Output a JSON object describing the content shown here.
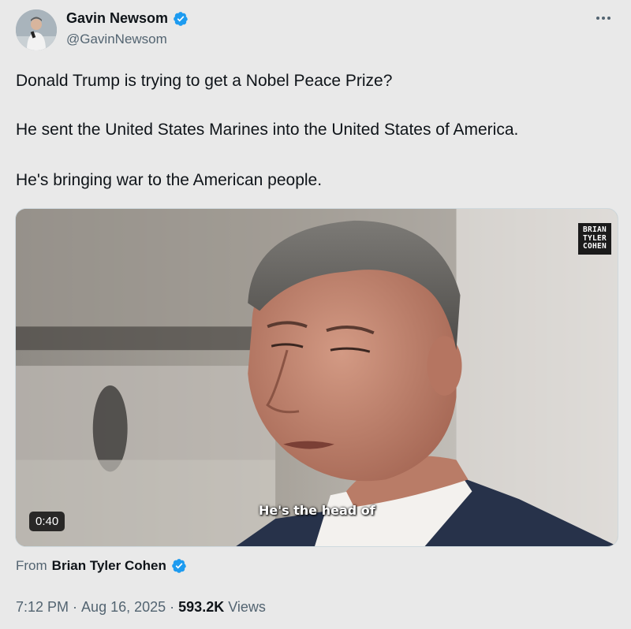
{
  "author": {
    "display_name": "Gavin Newsom",
    "handle": "@GavinNewsom",
    "verified_icon": "verified-badge-icon",
    "avatar_icon": "avatar-photo"
  },
  "menu": {
    "more_icon": "more-horizontal-icon"
  },
  "tweet": {
    "lines": [
      "Donald Trump is trying to get a Nobel Peace Prize?",
      "He sent the United States Marines into the United States of America.",
      "He's bringing war to the American people."
    ]
  },
  "media": {
    "watermark": [
      "BRIAN",
      "TYLER",
      "COHEN"
    ],
    "caption": "He's the head of",
    "duration": "0:40"
  },
  "source": {
    "from_label": "From",
    "name": "Brian Tyler Cohen"
  },
  "meta": {
    "time": "7:12 PM",
    "sep1": "·",
    "date": "Aug 16, 2025",
    "sep2": "·",
    "views_count": "593.2K",
    "views_label": "Views"
  },
  "colors": {
    "verified": "#1d9bf0",
    "secondary_text": "#536471",
    "primary_text": "#0f1419",
    "background": "#e9e9e9"
  }
}
